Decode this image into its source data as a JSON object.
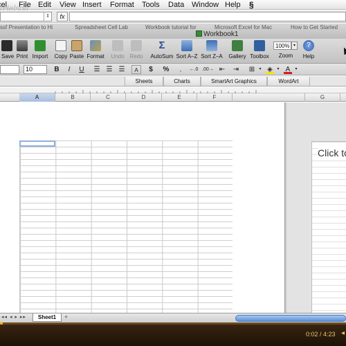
{
  "menubar": {
    "items": [
      "cel",
      "File",
      "Edit",
      "View",
      "Insert",
      "Format",
      "Tools",
      "Data",
      "Window",
      "Help"
    ],
    "script_icon": "script-menu-icon",
    "watermark": "rHelsoft"
  },
  "formula_bar": {
    "fx_label": "fx",
    "cell_reference": "",
    "formula_value": ""
  },
  "window": {
    "title": "Workbook1",
    "browser_tabs": [
      "ssf Presentation to Hi",
      "Spreadsheet Cell Lab",
      "Workbook tutorial for",
      "Microsoft Excel for Mac",
      "How to Get Started"
    ]
  },
  "toolbar": {
    "buttons": [
      {
        "label": "Save",
        "icon": "save-icon",
        "enabled": true
      },
      {
        "label": "Print",
        "icon": "print-icon",
        "enabled": true
      },
      {
        "label": "Import",
        "icon": "import-icon",
        "enabled": true
      },
      {
        "label": "Copy",
        "icon": "copy-icon",
        "enabled": true
      },
      {
        "label": "Paste",
        "icon": "paste-icon",
        "enabled": true
      },
      {
        "label": "Format",
        "icon": "format-painter-icon",
        "enabled": true
      },
      {
        "label": "Undo",
        "icon": "undo-icon",
        "enabled": false
      },
      {
        "label": "Redo",
        "icon": "redo-icon",
        "enabled": false
      },
      {
        "label": "AutoSum",
        "icon": "sigma-icon",
        "enabled": true
      },
      {
        "label": "Sort A–Z",
        "icon": "sort-ascending-icon",
        "enabled": true
      },
      {
        "label": "Sort Z–A",
        "icon": "sort-descending-icon",
        "enabled": true
      },
      {
        "label": "Gallery",
        "icon": "gallery-icon",
        "enabled": true
      },
      {
        "label": "Toolbox",
        "icon": "toolbox-icon",
        "enabled": true
      },
      {
        "label": "Zoom",
        "icon": "zoom-icon",
        "enabled": true
      },
      {
        "label": "Help",
        "icon": "help-icon",
        "enabled": true
      }
    ],
    "zoom_value": "100%"
  },
  "format_bar": {
    "font_name": "",
    "font_size": "10",
    "bold": "B",
    "italic": "I",
    "underline": "U",
    "currency": "$",
    "percent": "%"
  },
  "gallery_tabs": [
    "Sheets",
    "Charts",
    "SmartArt Graphics",
    "WordArt"
  ],
  "columns": [
    "A",
    "B",
    "C",
    "D",
    "E",
    "F",
    "G"
  ],
  "selected_column": "A",
  "textbox": {
    "text": "Click to"
  },
  "sheet_tabs": {
    "nav": "◂◂ ◂ ▸ ▸▸",
    "active": "Sheet1",
    "add": "+"
  },
  "video": {
    "time": "0:02 / 4:23",
    "progress": 0.008
  },
  "colors": {
    "selection": "#8fb0dc",
    "scrollbar": "#5b8fd6",
    "video_accent": "#f0b000"
  }
}
